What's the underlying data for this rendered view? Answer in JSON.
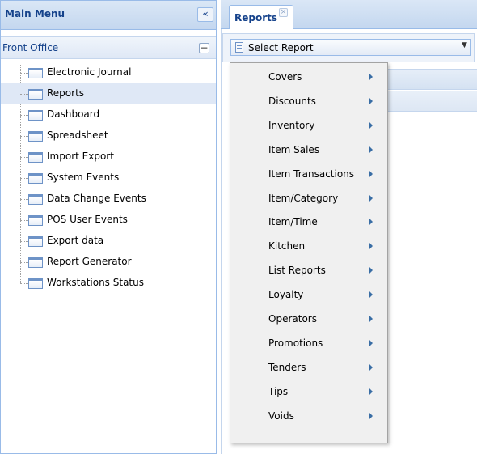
{
  "left_panel": {
    "title": "Main Menu",
    "collapse_symbol": "«",
    "section": {
      "title": "Front Office",
      "toggle_symbol": "−"
    },
    "tree_items": [
      {
        "label": "Electronic Journal",
        "selected": false
      },
      {
        "label": "Reports",
        "selected": true
      },
      {
        "label": "Dashboard",
        "selected": false
      },
      {
        "label": "Spreadsheet",
        "selected": false
      },
      {
        "label": "Import Export",
        "selected": false
      },
      {
        "label": "System Events",
        "selected": false
      },
      {
        "label": "Data Change Events",
        "selected": false
      },
      {
        "label": "POS User Events",
        "selected": false
      },
      {
        "label": "Export data",
        "selected": false
      },
      {
        "label": "Report Generator",
        "selected": false
      },
      {
        "label": "Workstations Status",
        "selected": false
      }
    ]
  },
  "tabs": [
    {
      "label": "Reports",
      "close_symbol": "×"
    }
  ],
  "report_select": {
    "value": "Select Report",
    "arrow_symbol": "▼",
    "icon": "report-list-icon"
  },
  "report_menu": {
    "submenu_icon": "submenu-arrow-icon",
    "items": [
      {
        "label": "Covers"
      },
      {
        "label": "Discounts"
      },
      {
        "label": "Inventory"
      },
      {
        "label": "Item Sales"
      },
      {
        "label": "Item Transactions"
      },
      {
        "label": "Item/Category"
      },
      {
        "label": "Item/Time"
      },
      {
        "label": "Kitchen"
      },
      {
        "label": "List Reports"
      },
      {
        "label": "Loyalty"
      },
      {
        "label": "Operators"
      },
      {
        "label": "Promotions"
      },
      {
        "label": "Tenders"
      },
      {
        "label": "Tips"
      },
      {
        "label": "Voids"
      }
    ]
  },
  "colors": {
    "header_text": "#15428b",
    "panel_border": "#99bbe8",
    "selection_bg": "#dfe8f6",
    "menu_bg": "#f0f0f0",
    "submenu_arrow": "#3a6ea5"
  }
}
